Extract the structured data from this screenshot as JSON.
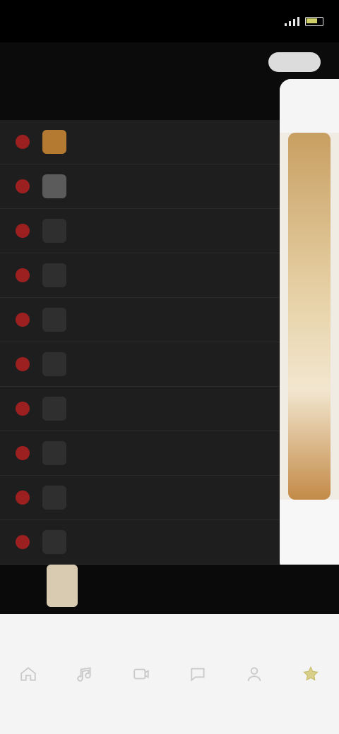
{
  "status_bar": {
    "time": "",
    "battery_color": "#cfd06a"
  },
  "top_tabs": {
    "items": [
      {
        "label": ""
      },
      {
        "label": ""
      },
      {
        "label": ""
      },
      {
        "label": ""
      },
      {
        "label": ""
      }
    ]
  },
  "section": {
    "title": "",
    "options": [
      "",
      ""
    ]
  },
  "ranking_list": {
    "items": [
      {
        "name": "",
        "meta": [
          "",
          "",
          ""
        ]
      },
      {
        "name": "",
        "meta": [
          "",
          "",
          ""
        ]
      },
      {
        "name": "",
        "meta": [
          "",
          "",
          ""
        ]
      },
      {
        "name": "",
        "meta": [
          "",
          "",
          ""
        ]
      },
      {
        "name": "",
        "meta": [
          "",
          "",
          ""
        ]
      },
      {
        "name": "",
        "meta": [
          "",
          "",
          ""
        ]
      },
      {
        "name": "",
        "meta": [
          "",
          "",
          ""
        ]
      },
      {
        "name": "",
        "meta": [
          "",
          "",
          ""
        ]
      },
      {
        "name": "",
        "meta": [
          "",
          "",
          ""
        ]
      },
      {
        "name": "",
        "meta": [
          "",
          "",
          ""
        ]
      }
    ]
  },
  "now_playing": {
    "label": ""
  },
  "bottom_nav": [
    {
      "icon": "home-icon"
    },
    {
      "icon": "music-icon"
    },
    {
      "icon": "video-icon"
    },
    {
      "icon": "message-icon"
    },
    {
      "icon": "profile-icon"
    },
    {
      "icon": "star-icon"
    }
  ],
  "colors": {
    "rank_badge": "#9c2020",
    "accent": "#cfd06a",
    "list_bg": "#1e1e1e"
  }
}
